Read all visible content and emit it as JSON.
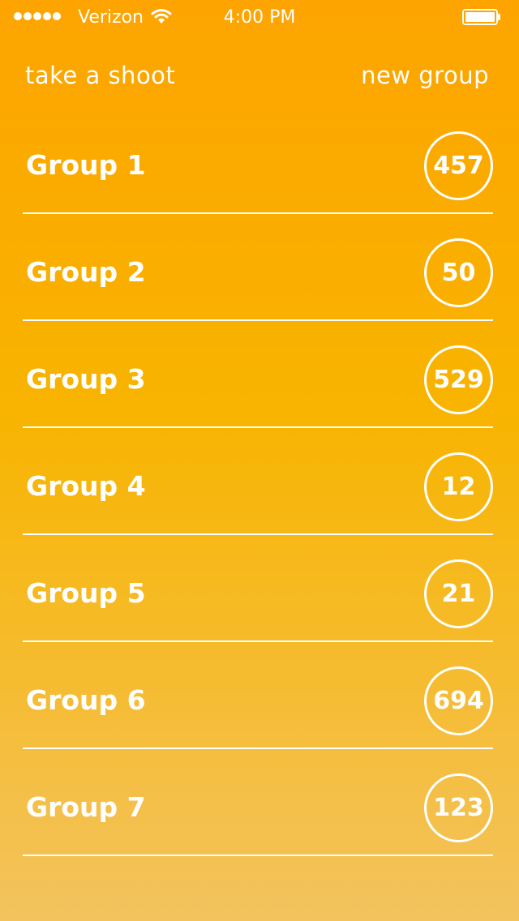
{
  "status_bar": {
    "carrier": "Verizon",
    "time": "4:00 PM",
    "signal_icon": "signal-dots-icon",
    "wifi_icon": "wifi-icon",
    "battery_icon": "battery-icon"
  },
  "nav": {
    "left_label": "take a shoot",
    "right_label": "new group"
  },
  "groups": [
    {
      "label": "Group 1",
      "count": "457"
    },
    {
      "label": "Group 2",
      "count": "50"
    },
    {
      "label": "Group 3",
      "count": "529"
    },
    {
      "label": "Group 4",
      "count": "12"
    },
    {
      "label": "Group 5",
      "count": "21"
    },
    {
      "label": "Group 6",
      "count": "694"
    },
    {
      "label": "Group 7",
      "count": "123"
    }
  ],
  "colors": {
    "gradient_top": "#fda400",
    "gradient_mid": "#f8b400",
    "gradient_bottom": "#f3c35e",
    "foreground": "#ffffff"
  }
}
